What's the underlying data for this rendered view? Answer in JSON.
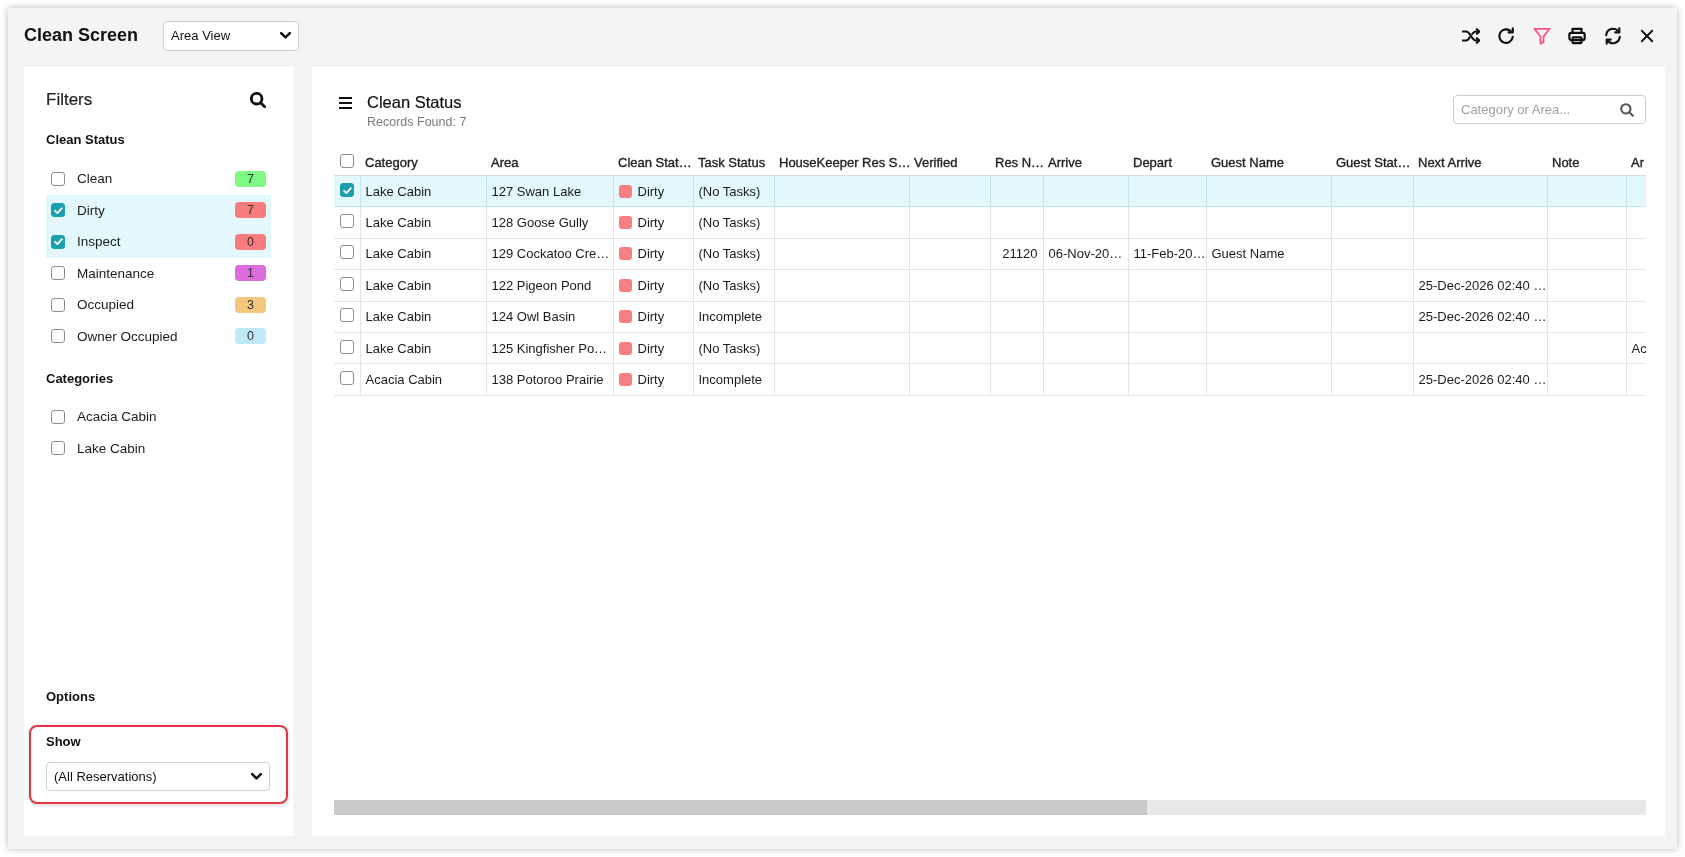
{
  "header": {
    "title": "Clean Screen",
    "view_select": {
      "value": "Area View"
    }
  },
  "toolbar": {
    "filter_active": true
  },
  "filters": {
    "title": "Filters",
    "sections": [
      {
        "heading": "Clean Status",
        "items": [
          {
            "label": "Clean",
            "checked": false,
            "count": "7",
            "color": "#7dfa84"
          },
          {
            "label": "Dirty",
            "checked": true,
            "count": "7",
            "color": "#f87c7c"
          },
          {
            "label": "Inspect",
            "checked": true,
            "count": "0",
            "color": "#f87c7c"
          },
          {
            "label": "Maintenance",
            "checked": false,
            "count": "1",
            "color": "#dc6edc"
          },
          {
            "label": "Occupied",
            "checked": false,
            "count": "3",
            "color": "#f5c77e"
          },
          {
            "label": "Owner Occupied",
            "checked": false,
            "count": "0",
            "color": "#bfe9f8"
          }
        ]
      },
      {
        "heading": "Categories",
        "items": [
          {
            "label": "Acacia Cabin",
            "checked": false
          },
          {
            "label": "Lake Cabin",
            "checked": false
          }
        ]
      }
    ]
  },
  "options": {
    "heading": "Options",
    "show": {
      "label": "Show",
      "value": "(All Reservations)",
      "highlighted": true
    }
  },
  "clean_status": {
    "title": "Clean Status",
    "records_found": "Records Found: 7",
    "search": {
      "placeholder": "Category or Area..."
    }
  },
  "table": {
    "select_all_checked": false,
    "columns": [
      "Category",
      "Area",
      "Clean Stat…",
      "Task Status",
      "HouseKeeper Res S…",
      "Verified",
      "Res N…",
      "Arrive",
      "Depart",
      "Guest Name",
      "Guest Stat…",
      "Next Arrive",
      "Note",
      "Ar"
    ],
    "rows": [
      {
        "selected": true,
        "category": "Lake Cabin",
        "area": "127 Swan Lake",
        "clean_status": {
          "label": "Dirty",
          "color": "#f77f7f"
        },
        "task_status": "(No Tasks)"
      },
      {
        "selected": false,
        "category": "Lake Cabin",
        "area": "128 Goose Gully",
        "clean_status": {
          "label": "Dirty",
          "color": "#f77f7f"
        },
        "task_status": "(No Tasks)"
      },
      {
        "selected": false,
        "category": "Lake Cabin",
        "area": "129 Cockatoo Cre…",
        "clean_status": {
          "label": "Dirty",
          "color": "#f77f7f"
        },
        "task_status": "(No Tasks)",
        "res_no": "21120",
        "arrive": "06-Nov-20…",
        "depart": "11-Feb-20…",
        "guest_name": "Guest Name"
      },
      {
        "selected": false,
        "category": "Lake Cabin",
        "area": "122 Pigeon Pond",
        "clean_status": {
          "label": "Dirty",
          "color": "#f77f7f"
        },
        "task_status": "(No Tasks)",
        "next_arrive": "25-Dec-2026 02:40 …"
      },
      {
        "selected": false,
        "category": "Lake Cabin",
        "area": "124 Owl Basin",
        "clean_status": {
          "label": "Dirty",
          "color": "#f77f7f"
        },
        "task_status": "Incomplete",
        "next_arrive": "25-Dec-2026 02:40 …"
      },
      {
        "selected": false,
        "category": "Lake Cabin",
        "area": "125 Kingfisher Po…",
        "clean_status": {
          "label": "Dirty",
          "color": "#f77f7f"
        },
        "task_status": "(No Tasks)",
        "column_14": "Ac"
      },
      {
        "selected": false,
        "category": "Acacia Cabin",
        "area": "138 Potoroo Prairie",
        "clean_status": {
          "label": "Dirty",
          "color": "#f77f7f"
        },
        "task_status": "Incomplete",
        "next_arrive": "25-Dec-2026 02:40 …"
      }
    ]
  }
}
